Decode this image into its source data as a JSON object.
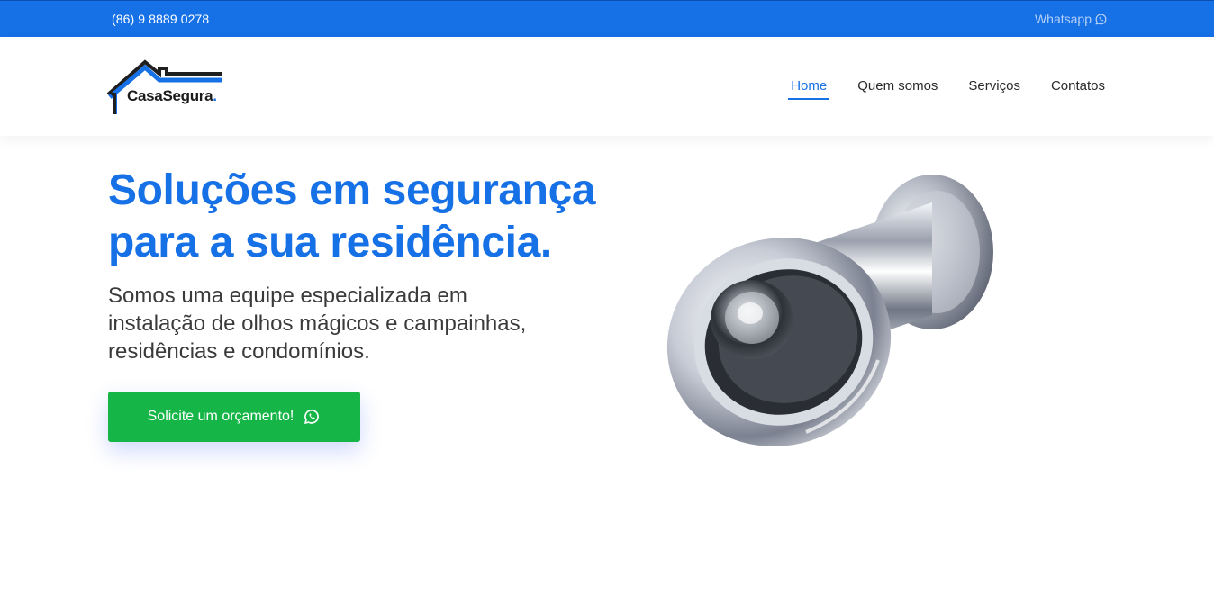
{
  "topbar": {
    "phone": "(86) 9 8889 0278",
    "whatsapp_label": "Whatsapp"
  },
  "header": {
    "logo": {
      "text": "CasaSegura",
      "dot": "."
    },
    "nav": [
      {
        "label": "Home",
        "active": true
      },
      {
        "label": "Quem somos",
        "active": false
      },
      {
        "label": "Serviços",
        "active": false
      },
      {
        "label": "Contatos",
        "active": false
      }
    ]
  },
  "hero": {
    "title_line1": "Soluções em segurança",
    "title_line2": "para a sua residência.",
    "subtitle_line1": "Somos uma equipe especializada em",
    "subtitle_line2": "instalação de olhos mágicos e campainhas,",
    "subtitle_line3": "residências e condomínios.",
    "cta_label": "Solicite um orçamento!",
    "cta_icon": "whatsapp-icon"
  },
  "colors": {
    "brand_blue": "#1670e6",
    "cta_green": "#16b548",
    "text_dark": "#3a3a3a"
  }
}
